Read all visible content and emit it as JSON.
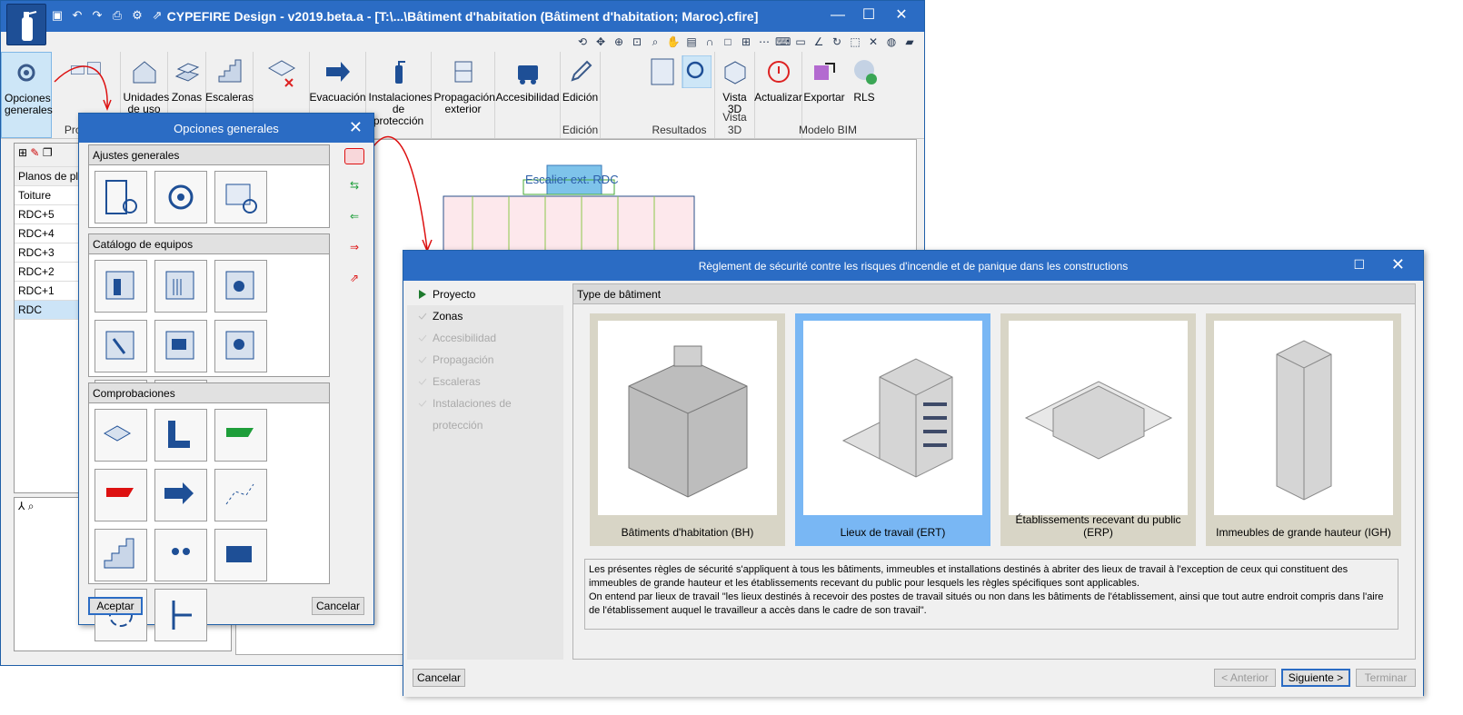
{
  "main_window": {
    "title": "CYPEFIRE Design - v2019.beta.a - [T:\\...\\Bâtiment d'habitation (Bâtiment d'habitation; Maroc).cfire]",
    "controls": {
      "minimize": "—",
      "maximize": "☐",
      "close": "✕"
    }
  },
  "ribbon": {
    "opciones_generales": "Opciones generales",
    "unidades": "Unidades de uso",
    "zonas": "Zonas",
    "escaleras": "Escaleras",
    "evacuacion": "Evacuación",
    "instalaciones": "Instalaciones de protección",
    "propagacion": "Propagación exterior",
    "accesibilidad": "Accesibilidad",
    "edicion": "Edición",
    "vista3d": "Vista 3D",
    "actualizar": "Actualizar",
    "exportar": "Exportar",
    "rls": "RLS",
    "groups": {
      "proyecto": "Proyecto",
      "edicion": "Edición",
      "resultados": "Resultados",
      "vista3d": "Vista 3D",
      "modelo_bim": "Modelo BIM"
    }
  },
  "floors_panel": {
    "header": "Planos de pla",
    "rows": [
      "Toiture",
      "RDC+5",
      "RDC+4",
      "RDC+3",
      "RDC+2",
      "RDC+1",
      "RDC"
    ]
  },
  "canvas": {
    "label": "Escalier ext. RDC"
  },
  "options_dialog": {
    "title": "Opciones generales",
    "sections": {
      "ajustes": "Ajustes generales",
      "catalogo": "Catálogo de equipos",
      "comprobaciones": "Comprobaciones"
    },
    "accept": "Aceptar",
    "cancel": "Cancelar"
  },
  "reg_dialog": {
    "title": "Règlement de sécurité contre les risques d'incendie et de panique dans les constructions",
    "nav": [
      "Proyecto",
      "Zonas",
      "Accesibilidad",
      "Propagación",
      "Escaleras",
      "Instalaciones de protección"
    ],
    "panel_header": "Type de bâtiment",
    "cards": [
      "Bâtiments d'habitation (BH)",
      "Lieux de travail (ERT)",
      "Établissements recevant du public (ERP)",
      "Immeubles de grande hauteur (IGH)"
    ],
    "description": "Les présentes règles de sécurité s'appliquent à tous les bâtiments, immeubles et installations destinés à abriter des lieux de travail à l'exception de ceux qui constituent des immeubles de grande hauteur et les établissements recevant du public pour lesquels les règles spécifiques sont applicables.\nOn entend par lieux de travail \"les lieux destinés à recevoir des postes de travail situés ou non dans les bâtiments de l'établissement, ainsi que tout autre endroit compris dans l'aire de l'établissement auquel le travailleur a accès dans le cadre de son travail\".",
    "buttons": {
      "cancel": "Cancelar",
      "prev": "< Anterior",
      "next": "Siguiente >",
      "finish": "Terminar"
    }
  },
  "colors": {
    "titlebar": "#2b6cc4",
    "selected_card": "#79b7f4",
    "card": "#d8d5c6"
  }
}
